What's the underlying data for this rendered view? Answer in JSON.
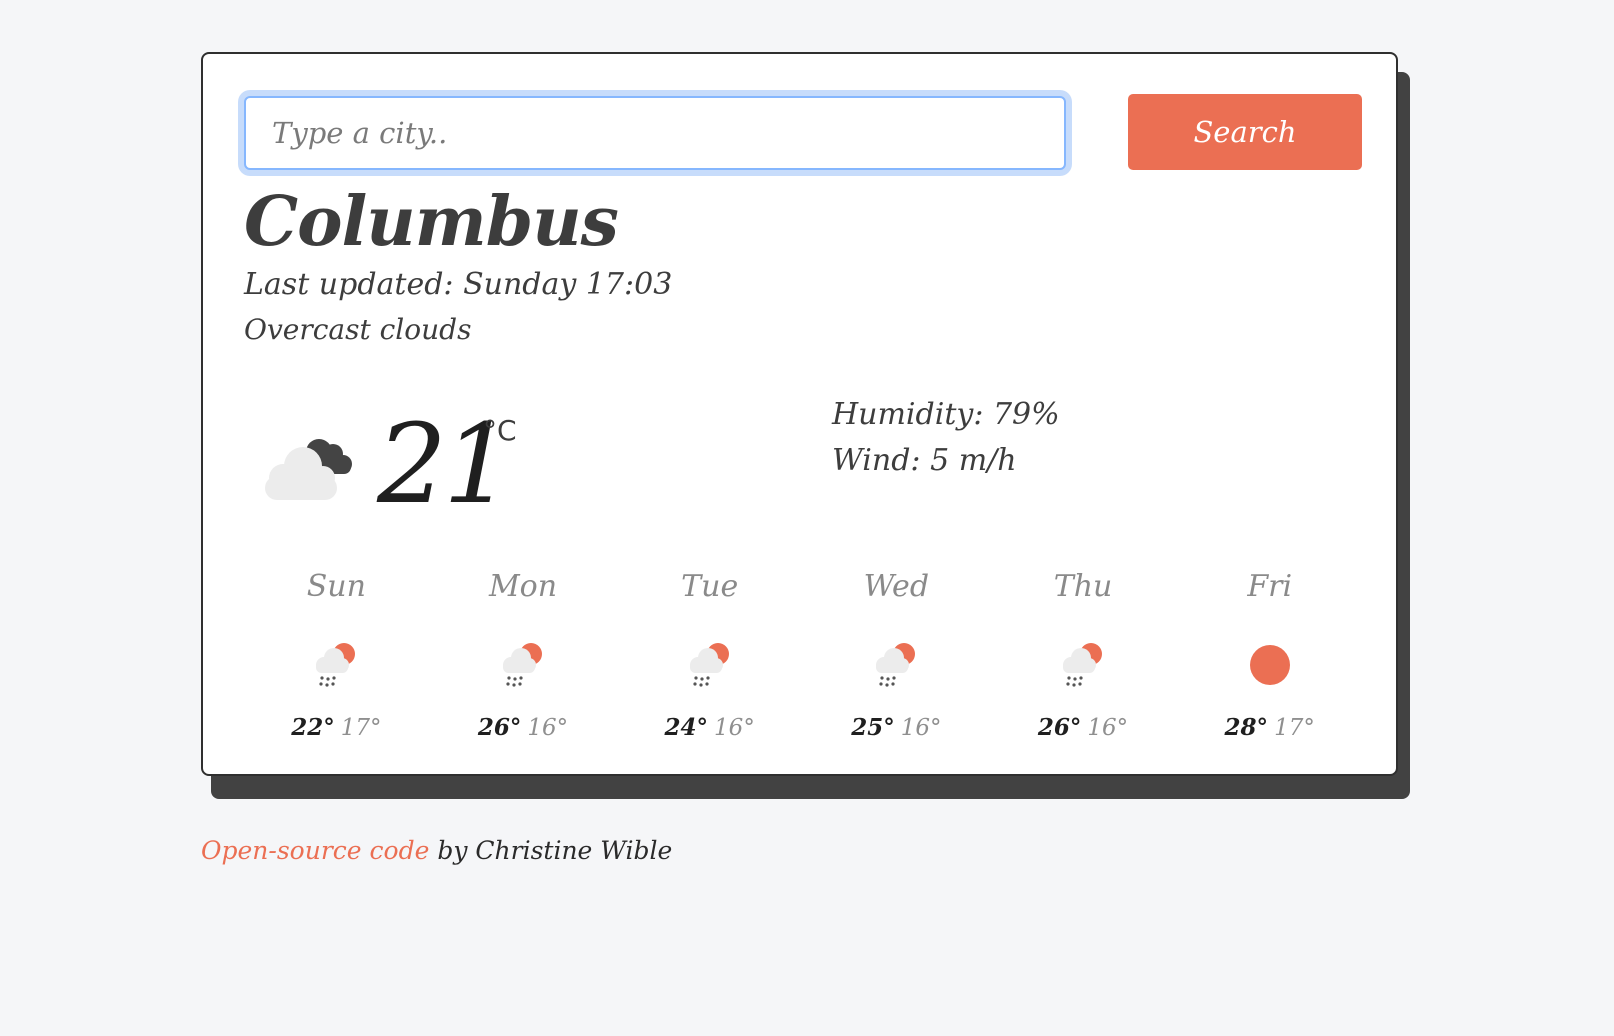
{
  "search": {
    "placeholder": "Type a city..",
    "value": "",
    "button_label": "Search"
  },
  "current": {
    "city": "Columbus",
    "updated_label": "Last updated:",
    "updated_time": "Sunday 17:03",
    "description": "Overcast clouds",
    "temperature": "21",
    "unit": "°C",
    "humidity_text": "Humidity: 79%",
    "wind_text": "Wind: 5 m/h",
    "icon": "overcast-clouds-icon"
  },
  "forecast": [
    {
      "day": "Sun",
      "max": "22°",
      "min": "17°",
      "icon": "rain-sun-icon"
    },
    {
      "day": "Mon",
      "max": "26°",
      "min": "16°",
      "icon": "rain-sun-icon"
    },
    {
      "day": "Tue",
      "max": "24°",
      "min": "16°",
      "icon": "rain-sun-icon"
    },
    {
      "day": "Wed",
      "max": "25°",
      "min": "16°",
      "icon": "rain-sun-icon"
    },
    {
      "day": "Thu",
      "max": "26°",
      "min": "16°",
      "icon": "rain-sun-icon"
    },
    {
      "day": "Fri",
      "max": "28°",
      "min": "17°",
      "icon": "sun-icon"
    }
  ],
  "footer": {
    "link_text": "Open-source code",
    "suffix_text": " by Christine Wible"
  },
  "colors": {
    "accent": "#eb6f53",
    "shadow": "#424242",
    "background": "#f5f6f8"
  }
}
